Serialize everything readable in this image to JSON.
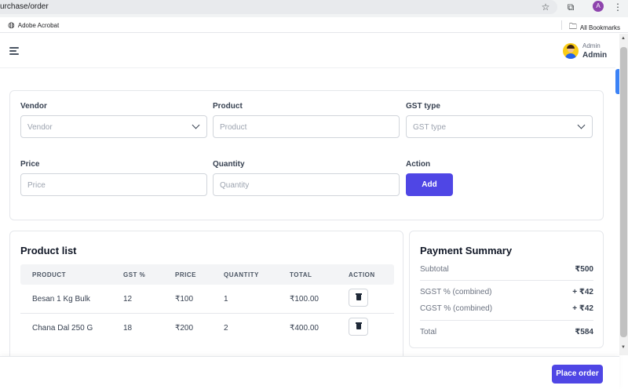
{
  "browser": {
    "url": "urchase/order",
    "bookmark_item": "Adobe Acrobat",
    "all_bookmarks": "All Bookmarks",
    "profile_initial": "A"
  },
  "header": {
    "user_role": "Admin",
    "user_name": "Admin"
  },
  "form": {
    "vendor_label": "Vendor",
    "vendor_placeholder": "Vendor",
    "product_label": "Product",
    "product_placeholder": "Product",
    "gst_label": "GST type",
    "gst_placeholder": "GST type",
    "price_label": "Price",
    "price_placeholder": "Price",
    "quantity_label": "Quantity",
    "quantity_placeholder": "Quantity",
    "action_label": "Action",
    "add_button": "Add"
  },
  "product_list": {
    "title": "Product list",
    "columns": [
      "PRODUCT",
      "GST %",
      "PRICE",
      "QUANTITY",
      "TOTAL",
      "ACTION"
    ],
    "rows": [
      {
        "product": "Besan 1 Kg Bulk",
        "gst": "12",
        "price": "₹100",
        "quantity": "1",
        "total": "₹100.00"
      },
      {
        "product": "Chana Dal 250 G",
        "gst": "18",
        "price": "₹200",
        "quantity": "2",
        "total": "₹400.00"
      }
    ]
  },
  "payment_summary": {
    "title": "Payment Summary",
    "subtotal_label": "Subtotal",
    "subtotal_value": "₹500",
    "sgst_label": "SGST % (combined)",
    "sgst_value": "+ ₹42",
    "cgst_label": "CGST % (combined)",
    "cgst_value": "+ ₹42",
    "total_label": "Total",
    "total_value": "₹584"
  },
  "footer": {
    "place_order": "Place order"
  },
  "colors": {
    "accent": "#4f46e5",
    "scroll_tab": "#3b82f6"
  }
}
